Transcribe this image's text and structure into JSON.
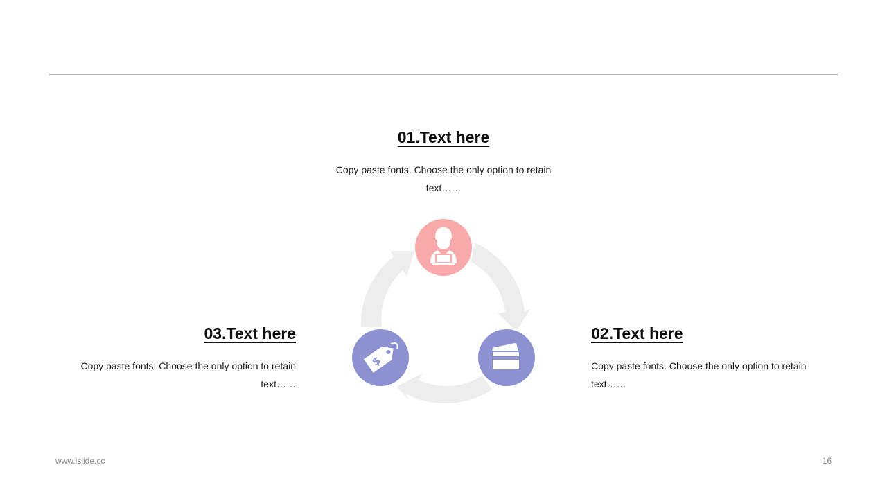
{
  "items": [
    {
      "number_title": "01.Text here",
      "description": "Copy paste fonts. Choose the only option to retain text……",
      "icon": "person-laptop-icon",
      "color": "#f8aaab"
    },
    {
      "number_title": "02.Text here",
      "description": "Copy paste fonts. Choose the only option to retain text……",
      "icon": "credit-card-icon",
      "color": "#8c92d1"
    },
    {
      "number_title": "03.Text here",
      "description": "Copy paste fonts. Choose the only option to retain text……",
      "icon": "price-tag-icon",
      "color": "#8c92d1"
    }
  ],
  "arrow_color": "#ededed",
  "footer": {
    "website": "www.islide.cc",
    "page_number": "16"
  }
}
